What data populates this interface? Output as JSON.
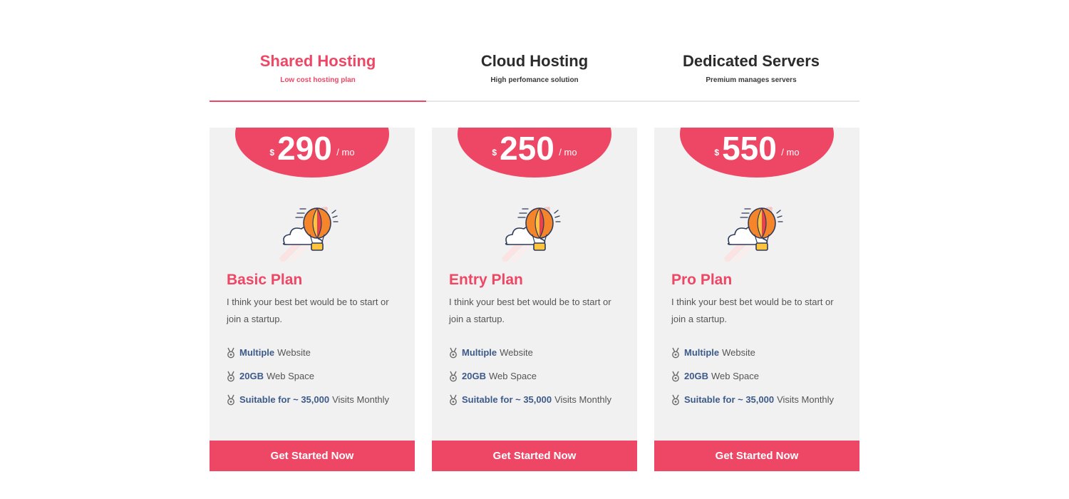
{
  "tabs": [
    {
      "title": "Shared Hosting",
      "subtitle": "Low cost hosting plan",
      "active": true
    },
    {
      "title": "Cloud Hosting",
      "subtitle": "High perfomance solution",
      "active": false
    },
    {
      "title": "Dedicated Servers",
      "subtitle": "Premium manages servers",
      "active": false
    }
  ],
  "accent_color": "#ee4765",
  "plans": [
    {
      "currency": "$",
      "price": "290",
      "period": "/ mo",
      "icon": "hot-air-balloon-icon",
      "name": "Basic Plan",
      "description": "I think your best bet would be to start or join a startup.",
      "features": [
        {
          "strong": "Multiple",
          "text": "Website"
        },
        {
          "strong": "20GB",
          "text": "Web Space"
        },
        {
          "strong": "Suitable for ~ 35,000",
          "text": "Visits Monthly"
        }
      ],
      "cta": "Get Started Now"
    },
    {
      "currency": "$",
      "price": "250",
      "period": "/ mo",
      "icon": "hot-air-balloon-icon",
      "name": "Entry Plan",
      "description": "I think your best bet would be to start or join a startup.",
      "features": [
        {
          "strong": "Multiple",
          "text": "Website"
        },
        {
          "strong": "20GB",
          "text": "Web Space"
        },
        {
          "strong": "Suitable for ~ 35,000",
          "text": "Visits Monthly"
        }
      ],
      "cta": "Get Started Now"
    },
    {
      "currency": "$",
      "price": "550",
      "period": "/ mo",
      "icon": "hot-air-balloon-icon",
      "name": "Pro Plan",
      "description": "I think your best bet would be to start or join a startup.",
      "features": [
        {
          "strong": "Multiple",
          "text": "Website"
        },
        {
          "strong": "20GB",
          "text": "Web Space"
        },
        {
          "strong": "Suitable for ~ 35,000",
          "text": "Visits Monthly"
        }
      ],
      "cta": "Get Started Now"
    }
  ]
}
